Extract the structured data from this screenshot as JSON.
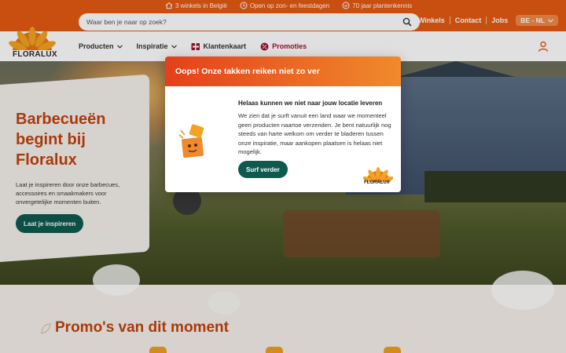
{
  "topbar": {
    "info": [
      {
        "icon": "home-icon",
        "text": "3 winkels in België"
      },
      {
        "icon": "clock-icon",
        "text": "Open op zon- en feestdagen"
      },
      {
        "icon": "badge-icon",
        "text": "70 jaar plantenkennis"
      }
    ],
    "search_placeholder": "Waar ben je naar op zoek?",
    "links": [
      "Winkels",
      "Contact",
      "Jobs"
    ],
    "language": "BE - NL"
  },
  "brand": {
    "name": "FLORALUX"
  },
  "nav": {
    "items": [
      {
        "label": "Producten",
        "dropdown": true
      },
      {
        "label": "Inspiratie",
        "dropdown": true
      },
      {
        "label": "Klantenkaart",
        "icon": "card-icon"
      },
      {
        "label": "Promoties",
        "icon": "percent-icon"
      }
    ]
  },
  "hero": {
    "title": "Barbecueën begint bij Floralux",
    "subtitle": "Laat je inspireren door onze barbecues, accessoires en smaakmakers voor onvergetelijke momenten buiten.",
    "cta": "Laat je inspireren"
  },
  "promos": {
    "heading": "Promo's van dit moment"
  },
  "modal": {
    "title": "Oops! Onze takken reiken niet zo ver",
    "subtitle": "Helaas kunnen we niet naar jouw locatie leveren",
    "text": "We zien dat je surft vanuit een land waar we momenteel geen producten naartoe verzenden. Je bent natuurlijk nog steeds van harte welkom om verder te bladeren tussen onze inspiratie, maar aankopen plaatsen is helaas niet mogelijk.",
    "button": "Surf verder",
    "logo_text": "FLORALUX"
  },
  "colors": {
    "brand_orange": "#e45a12",
    "accent_dark_green": "#0f5a4f",
    "heading_orange": "#c2410c",
    "promo_red": "#a0122e"
  }
}
